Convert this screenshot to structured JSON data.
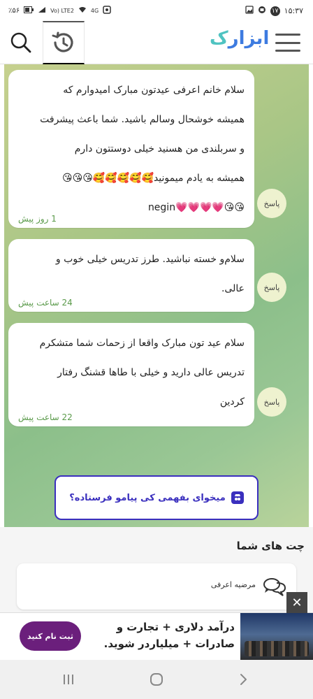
{
  "status_bar": {
    "battery": "٪۵۶",
    "network": "Vo) LTE2",
    "signal_type": "4G",
    "notification_count": "۱۷",
    "time": "۱۵:۳۷"
  },
  "header": {
    "brand_main": "ابزار",
    "brand_accent": "ک"
  },
  "messages": [
    {
      "lines": [
        "سلام خانم اعرفی عیدتون مبارک امیدوارم که",
        "همیشه خوشحال وسالم باشید. شما باعث پیشرفت",
        "و سربلندی من هسنید خیلی دوستتون دارم",
        "همیشه به یادم میمونید🥰🥰🥰🥰🥰😘😘😘"
      ],
      "emoji_line": "😘😘💗💗💗💗negin",
      "time": "1 روز پیش",
      "reply_label": "پاسخ"
    },
    {
      "lines": [
        "سلام‌و خسته نباشید. طرز تدریس خیلی خوب و",
        "عالی."
      ],
      "time": "24 ساعت پیش",
      "reply_label": "پاسخ"
    },
    {
      "lines": [
        "سلام عید تون مبارک واقعا از زحمات شما متشکرم",
        "تدریس عالی دارید و خیلی با طاها قشنگ رفتار",
        "کردین"
      ],
      "time": "22 ساعت پیش",
      "reply_label": "پاسخ"
    }
  ],
  "cta": {
    "text": "میخوای بفهمی کی پیامو فرستاده؟"
  },
  "your_chats": {
    "title": "چت های شما",
    "items": [
      {
        "name": "مرضیه اعرفی"
      }
    ]
  },
  "ad": {
    "line1": "درآمد دلاری + تجارت و",
    "line2": "صادرات + میلیاردر شوید.",
    "button": "ثبت نام کنید",
    "close": "✕"
  },
  "colors": {
    "brand_blue": "#3d7be0",
    "brand_teal": "#4fc3c1",
    "cta_purple": "#3a2fbe",
    "ad_button": "#6b1f7c",
    "time_green": "#5a9a4a"
  }
}
